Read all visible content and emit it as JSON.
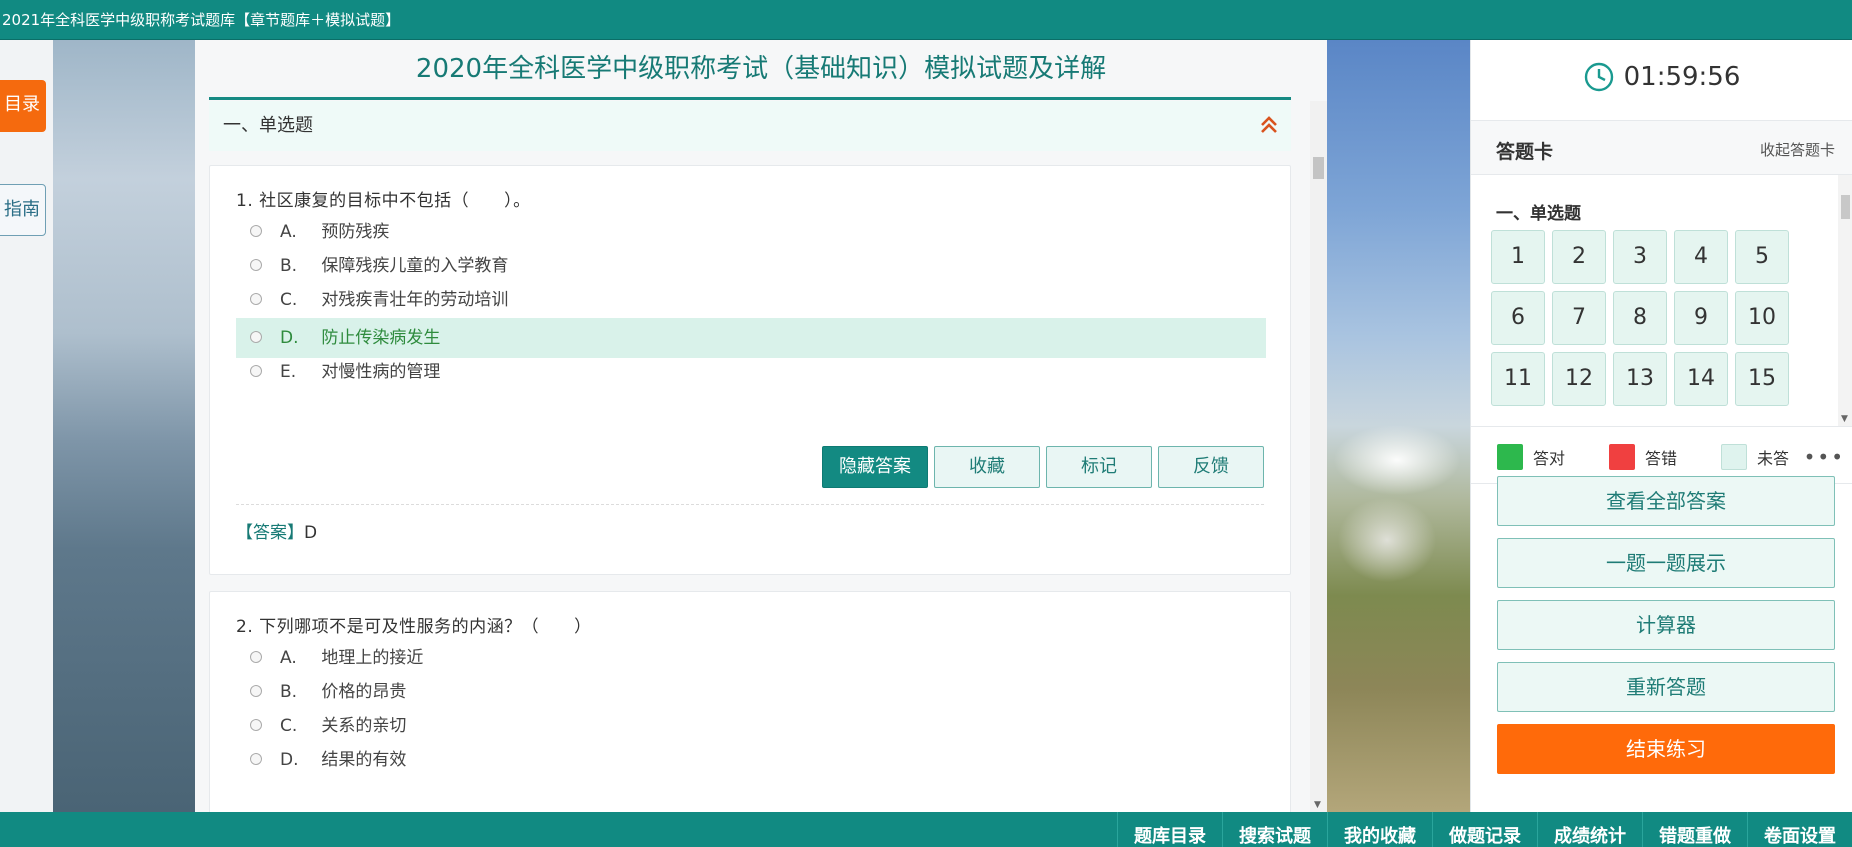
{
  "window": {
    "title": "2021年全科医学中级职称考试题库【章节题库＋模拟试题】"
  },
  "side": {
    "menu_label": "目录",
    "guide_label": "指南"
  },
  "main": {
    "title": "2020年全科医学中级职称考试（基础知识）模拟试题及详解",
    "section": "一、单选题",
    "questions": [
      {
        "stem": "1. 社区康复的目标中不包括（　　）。",
        "options": [
          {
            "letter": "A.",
            "text": "预防残疾"
          },
          {
            "letter": "B.",
            "text": "保障残疾儿童的入学教育"
          },
          {
            "letter": "C.",
            "text": "对残疾青壮年的劳动培训"
          },
          {
            "letter": "D.",
            "text": "防止传染病发生"
          },
          {
            "letter": "E.",
            "text": "对慢性病的管理"
          }
        ],
        "buttons": {
          "hide_answer": "隐藏答案",
          "favorite": "收藏",
          "mark": "标记",
          "feedback": "反馈"
        },
        "answer_tag": "【答案】",
        "answer_value": "D"
      },
      {
        "stem": "2. 下列哪项不是可及性服务的内涵？（　　）",
        "options": [
          {
            "letter": "A.",
            "text": "地理上的接近"
          },
          {
            "letter": "B.",
            "text": "价格的昂贵"
          },
          {
            "letter": "C.",
            "text": "关系的亲切"
          },
          {
            "letter": "D.",
            "text": "结果的有效"
          }
        ]
      }
    ]
  },
  "right": {
    "timer": "01:59:56",
    "card_title": "答题卡",
    "card_collapse": "收起答题卡",
    "card_section": "一、单选题",
    "numbers": [
      "1",
      "2",
      "3",
      "4",
      "5",
      "6",
      "7",
      "8",
      "9",
      "10",
      "11",
      "12",
      "13",
      "14",
      "15"
    ],
    "legend": {
      "correct": "答对",
      "wrong": "答错",
      "unanswered": "未答"
    },
    "legend_colors": {
      "correct": "#2db84d",
      "wrong": "#f04040",
      "unanswered": "#dff3ee"
    },
    "actions": {
      "view_all": "查看全部答案",
      "one_by_one": "一题一题展示",
      "calculator": "计算器",
      "restart": "重新答题",
      "end": "结束练习"
    }
  },
  "bottom_nav": [
    "题库目录",
    "搜索试题",
    "我的收藏",
    "做题记录",
    "成绩统计",
    "错题重做",
    "卷面设置"
  ]
}
